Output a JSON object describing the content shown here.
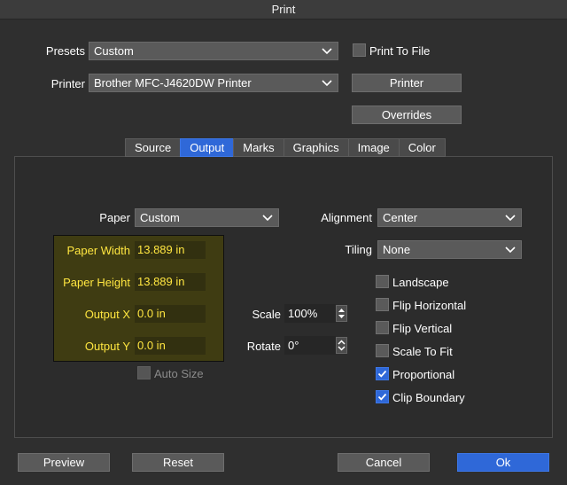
{
  "window": {
    "title": "Print"
  },
  "presets": {
    "label": "Presets",
    "value": "Custom"
  },
  "printer": {
    "label": "Printer",
    "value": "Brother MFC-J4620DW Printer"
  },
  "print_to_file": {
    "label": "Print To File",
    "checked": false
  },
  "buttons": {
    "printer": "Printer",
    "overrides": "Overrides",
    "preview": "Preview",
    "reset": "Reset",
    "cancel": "Cancel",
    "ok": "Ok"
  },
  "tabs": [
    {
      "label": "Source",
      "active": false
    },
    {
      "label": "Output",
      "active": true
    },
    {
      "label": "Marks",
      "active": false
    },
    {
      "label": "Graphics",
      "active": false
    },
    {
      "label": "Image",
      "active": false
    },
    {
      "label": "Color",
      "active": false
    }
  ],
  "paper": {
    "label": "Paper",
    "value": "Custom"
  },
  "paper_settings": {
    "width_label": "Paper Width",
    "width_value": "13.889 in",
    "height_label": "Paper Height",
    "height_value": "13.889 in",
    "outx_label": "Output X",
    "outx_value": "0.0 in",
    "outy_label": "Output Y",
    "outy_value": "0.0 in"
  },
  "auto_size": {
    "label": "Auto Size",
    "checked": false,
    "disabled": true
  },
  "scale": {
    "label": "Scale",
    "value": "100%"
  },
  "rotate": {
    "label": "Rotate",
    "value": "0°"
  },
  "alignment": {
    "label": "Alignment",
    "value": "Center"
  },
  "tiling": {
    "label": "Tiling",
    "value": "None"
  },
  "options": {
    "landscape": {
      "label": "Landscape",
      "checked": false
    },
    "flip_horizontal": {
      "label": "Flip Horizontal",
      "checked": false
    },
    "flip_vertical": {
      "label": "Flip Vertical",
      "checked": false
    },
    "scale_to_fit": {
      "label": "Scale To Fit",
      "checked": false
    },
    "proportional": {
      "label": "Proportional",
      "checked": true
    },
    "clip_boundary": {
      "label": "Clip Boundary",
      "checked": true
    }
  },
  "colors": {
    "accent": "#2f68d8",
    "highlight_text": "#ffe640",
    "background": "#2f2f2f"
  }
}
